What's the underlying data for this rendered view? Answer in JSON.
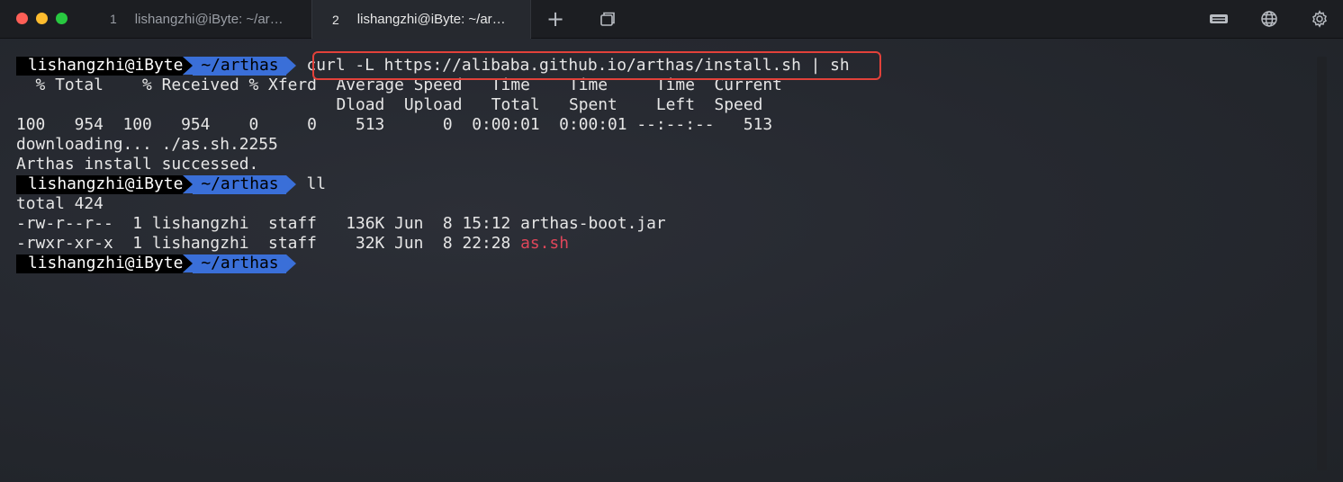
{
  "window": {
    "tabs": [
      {
        "number": "1",
        "title": "lishangzhi@iByte: ~/ar…",
        "active": false
      },
      {
        "number": "2",
        "title": "lishangzhi@iByte: ~/ar…",
        "active": true
      }
    ],
    "new_tab_glyph": "+",
    "icons": [
      "keyboard-icon",
      "globe-icon",
      "gear-icon"
    ]
  },
  "prompt": {
    "user_host": "lishangzhi@iByte",
    "dir": "~/arthas"
  },
  "terminal": {
    "cmd1": "curl -L https://alibaba.github.io/arthas/install.sh | sh",
    "curl_header1": "  % Total    % Received % Xferd  Average Speed   Time    Time     Time  Current",
    "curl_header2": "                                 Dload  Upload   Total   Spent    Left  Speed",
    "curl_progress": "100   954  100   954    0     0    513      0  0:00:01  0:00:01 --:--:--   513",
    "downloading": "downloading... ./as.sh.2255",
    "success": "Arthas install successed.",
    "cmd2": "ll",
    "total": "total 424",
    "file1_prefix": "-rw-r--r--  1 lishangzhi  staff   136K Jun  8 15:12 ",
    "file1_name": "arthas-boot.jar",
    "file2_prefix": "-rwxr-xr-x  1 lishangzhi  staff    32K Jun  8 22:28 ",
    "file2_name": "as.sh"
  },
  "colors": {
    "prompt_dir_bg": "#3a6fd8",
    "executable": "#e0465a",
    "highlight": "#e2413a"
  }
}
